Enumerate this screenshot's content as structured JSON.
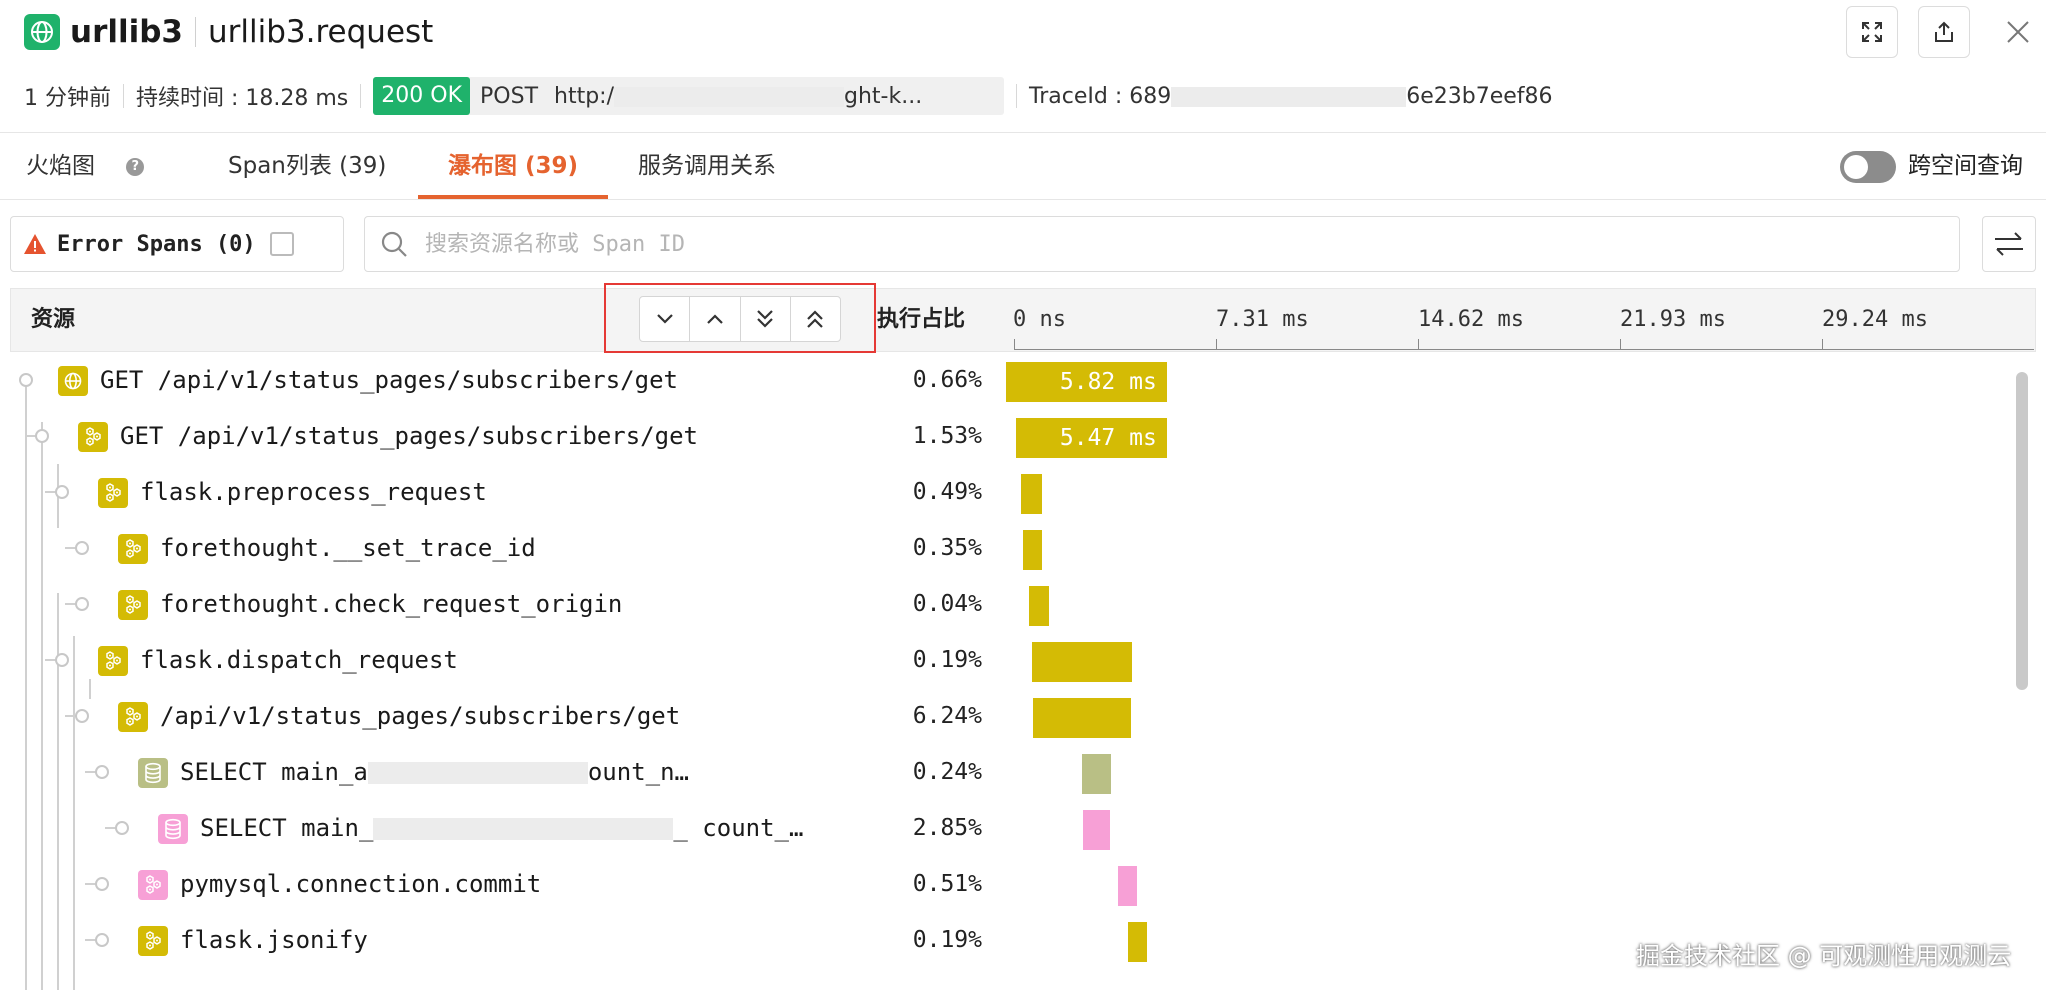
{
  "header": {
    "app_name": "urllib3",
    "span_name": "urllib3.request",
    "time_ago": "1 分钟前",
    "duration": "持续时间 : 18.28 ms",
    "status": "200 OK",
    "method": "POST",
    "url": "http:/",
    "url_tail": "ght-k...",
    "trace_id": "TraceId : 689",
    "trace_id_tail": "6e23b7eef86"
  },
  "tabs": [
    {
      "label": "火焰图"
    },
    {
      "label": "Span列表 (39)"
    },
    {
      "label": "瀑布图 (39)"
    },
    {
      "label": "服务调用关系"
    }
  ],
  "cross_space": {
    "label": "跨空间查询",
    "enabled": false
  },
  "filter": {
    "error_label": "Error Spans (0)",
    "search_placeholder": "搜索资源名称或 Span ID"
  },
  "table": {
    "col_resource": "资源",
    "col_ratio": "执行占比",
    "ticks": [
      "0 ns",
      "7.31 ms",
      "14.62 ms",
      "21.93 ms",
      "29.24 ms"
    ],
    "timeline_max_ms": 36.55,
    "rows": [
      {
        "name": "GET /api/v1/status_pages/subscribers/get",
        "ratio": "0.66%",
        "start_ms": 0,
        "duration_ms": 5.82,
        "label": "5.82 ms",
        "icon": "globe-icon",
        "color": "#d4bb05"
      },
      {
        "name": "GET /api/v1/status_pages/subscribers/get",
        "ratio": "1.53%",
        "start_ms": 0.35,
        "duration_ms": 5.47,
        "label": "5.47 ms",
        "icon": "hexagon-gear-icon",
        "color": "#d4bb05"
      },
      {
        "name": "flask.preprocess_request",
        "ratio": "0.49%",
        "start_ms": 0.55,
        "duration_ms": 0.75,
        "label": "",
        "icon": "hexagon-gear-icon",
        "color": "#d4bb05"
      },
      {
        "name": "forethought.__set_trace_id",
        "ratio": "0.35%",
        "start_ms": 0.6,
        "duration_ms": 0.7,
        "label": "",
        "icon": "hexagon-gear-icon",
        "color": "#d4bb05"
      },
      {
        "name": "forethought.check_request_origin",
        "ratio": "0.04%",
        "start_ms": 0.85,
        "duration_ms": 0.7,
        "label": "",
        "icon": "hexagon-gear-icon",
        "color": "#d4bb05"
      },
      {
        "name": "flask.dispatch_request",
        "ratio": "0.19%",
        "start_ms": 0.95,
        "duration_ms": 3.6,
        "label": "",
        "icon": "hexagon-gear-icon",
        "color": "#d4bb05"
      },
      {
        "name": "/api/v1/status_pages/subscribers/get",
        "ratio": "6.24%",
        "start_ms": 0.97,
        "duration_ms": 3.55,
        "label": "",
        "icon": "hexagon-gear-icon",
        "color": "#d4bb05"
      },
      {
        "name": "SELECT main_a",
        "name_tail": "ount_n…",
        "ratio": "0.24%",
        "start_ms": 2.75,
        "duration_ms": 1.05,
        "label": "",
        "icon": "database-icon",
        "color": "#b9bf85"
      },
      {
        "name": "SELECT main_",
        "name_tail": "_ count_…",
        "ratio": "2.85%",
        "start_ms": 2.8,
        "duration_ms": 0.95,
        "label": "",
        "icon": "database-icon",
        "color": "#f7a0d6"
      },
      {
        "name": "pymysql.connection.commit",
        "ratio": "0.51%",
        "start_ms": 4.05,
        "duration_ms": 0.7,
        "label": "",
        "icon": "hexagon-gear-icon",
        "color": "#f7a0d6"
      },
      {
        "name": "flask.jsonify",
        "ratio": "0.19%",
        "start_ms": 4.4,
        "duration_ms": 0.7,
        "label": "",
        "icon": "hexagon-gear-icon",
        "color": "#d4bb05"
      }
    ]
  },
  "watermark": "掘金技术社区 @ 可观测性用观测云"
}
